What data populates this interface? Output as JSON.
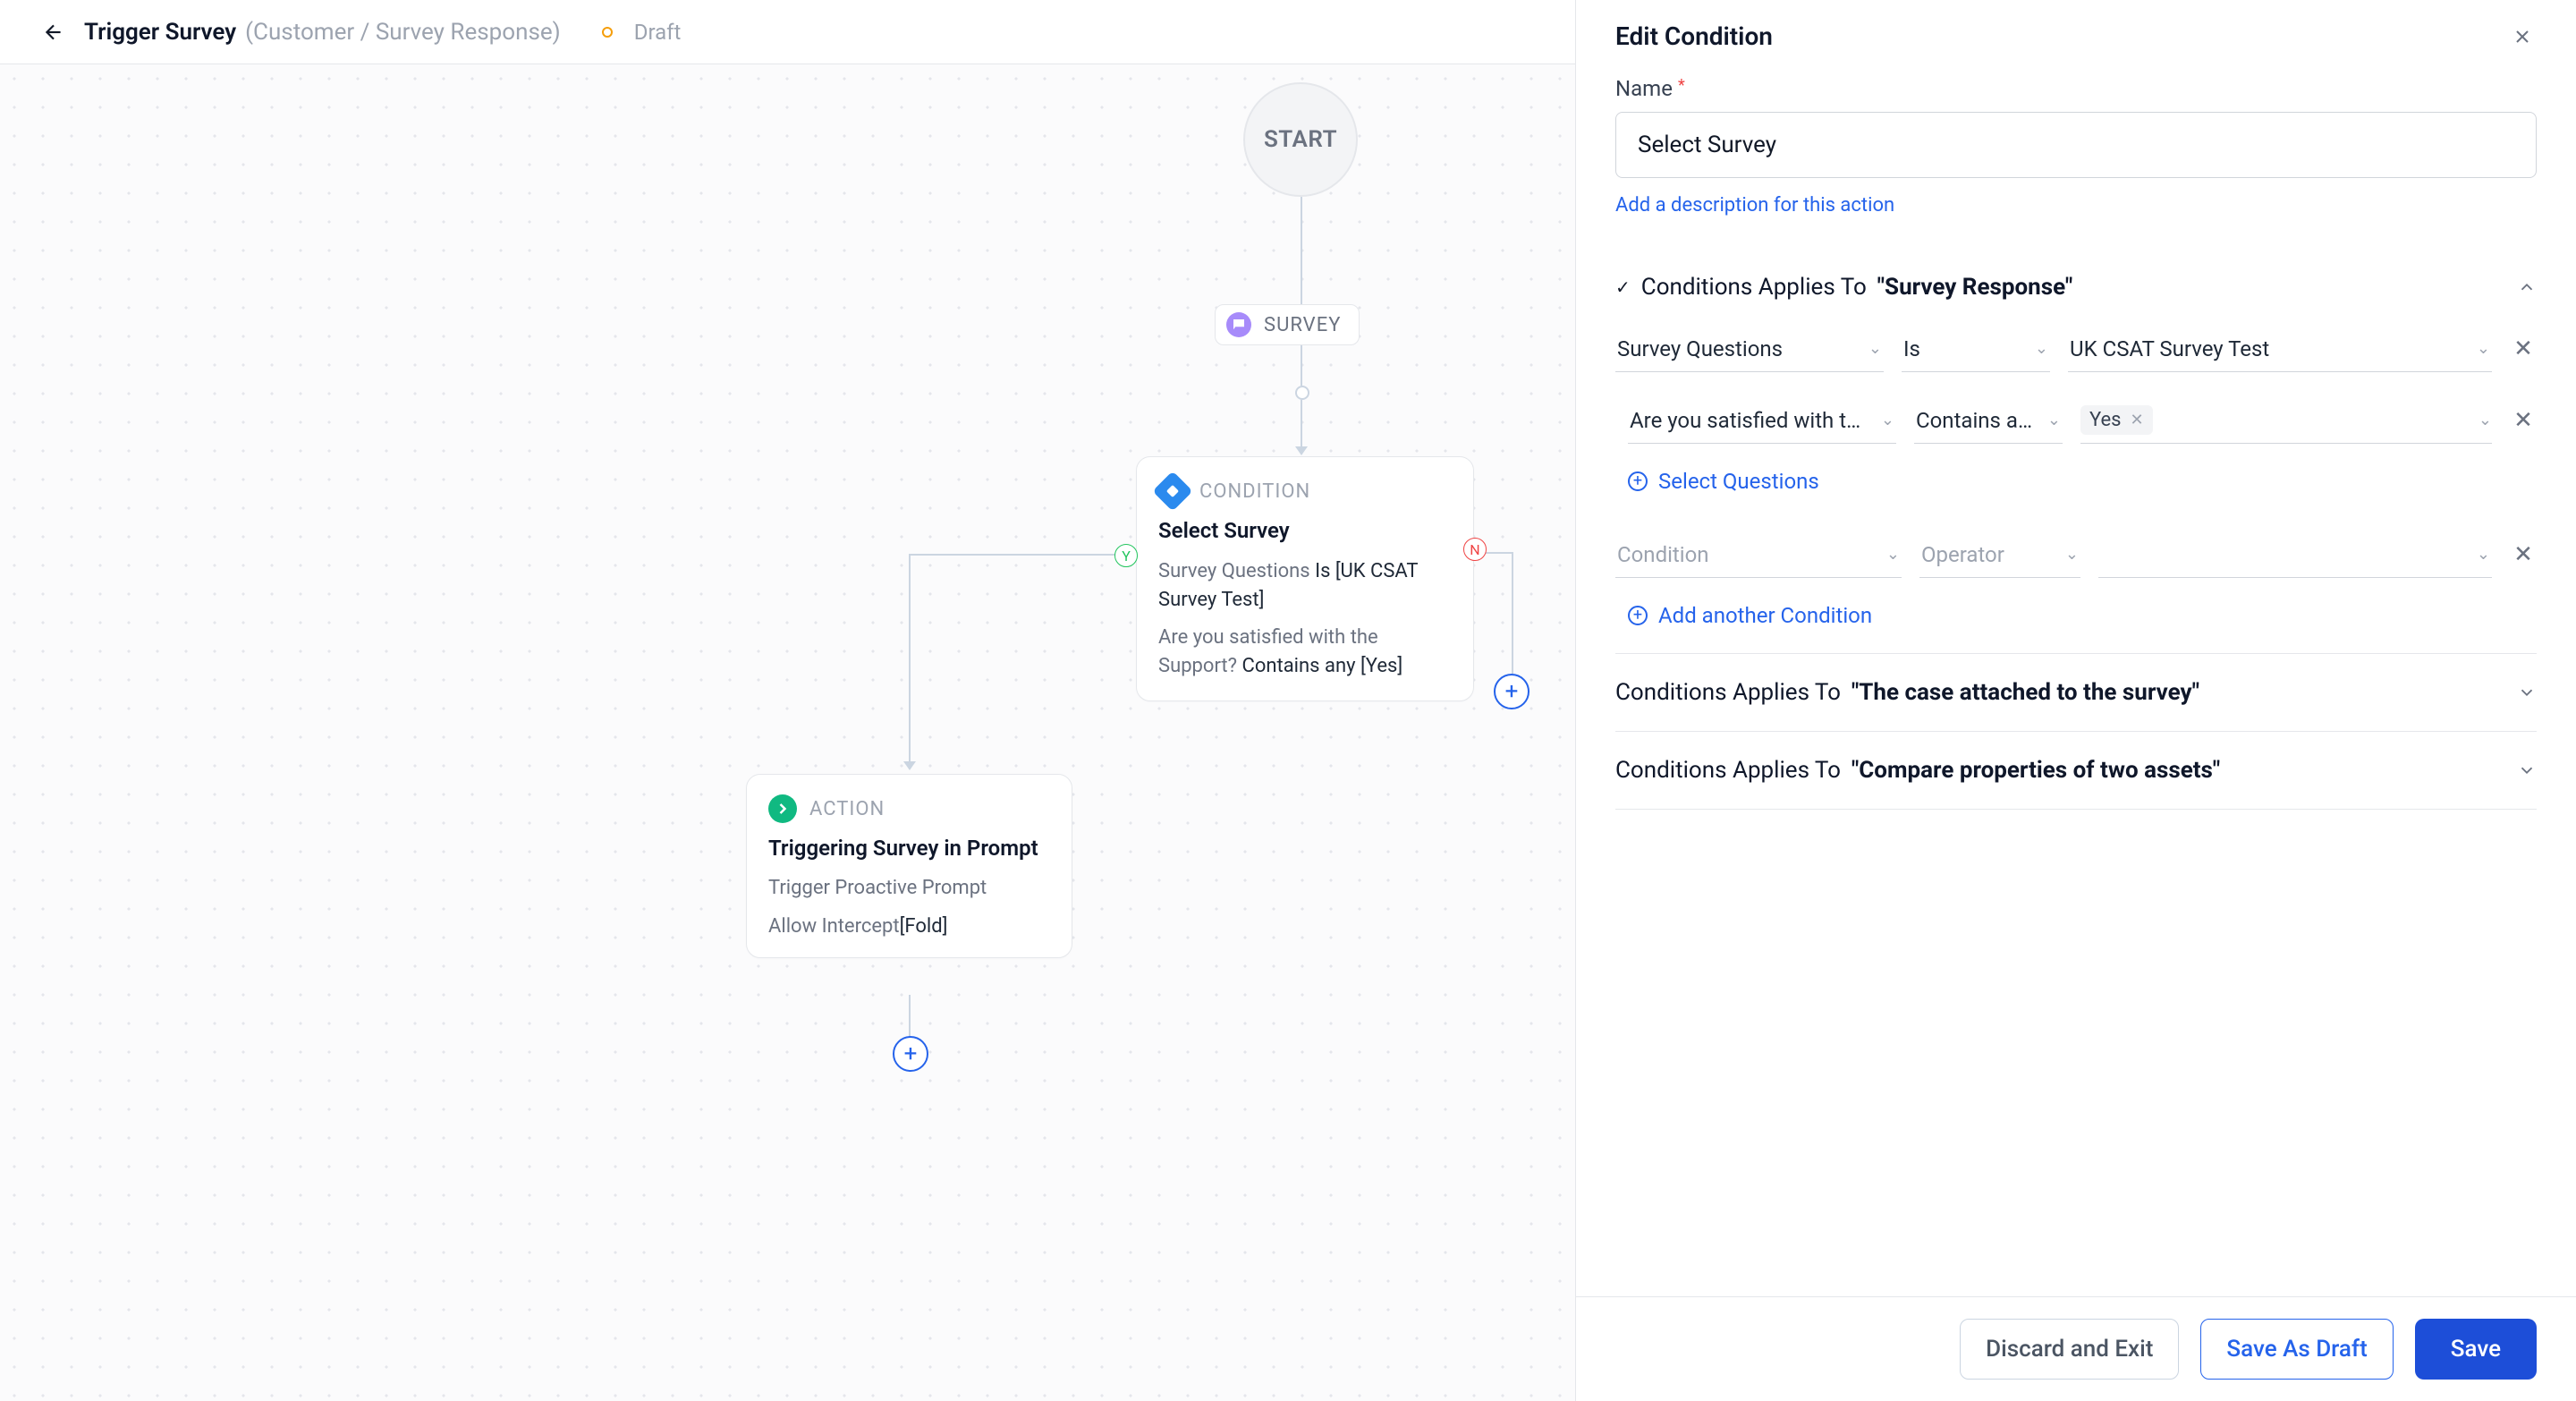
{
  "header": {
    "title": "Trigger Survey",
    "subtitle": "(Customer / Survey Response)",
    "status": "Draft"
  },
  "flow": {
    "start_label": "START",
    "survey_pill": "SURVEY",
    "condition": {
      "type_label": "CONDITION",
      "title": "Select Survey",
      "line1_prefix": "Survey Questions ",
      "line1_strong": "Is [UK CSAT Survey Test]",
      "line2_prefix": "Are you satisfied with the Support? ",
      "line2_strong": "Contains any [Yes]",
      "yes": "Y",
      "no": "N"
    },
    "action": {
      "type_label": "ACTION",
      "title": "Triggering Survey in Prompt",
      "row1": "Trigger Proactive Prompt",
      "row2_prefix": "Allow Intercept",
      "row2_strong": "[Fold]"
    }
  },
  "panel": {
    "title": "Edit Condition",
    "name_label": "Name",
    "name_value": "Select Survey",
    "add_description": "Add a description for this action",
    "sections": {
      "s1_prefix": "Conditions Applies To ",
      "s1_strong": "\"Survey Response\"",
      "s2_prefix": "Conditions Applies To ",
      "s2_strong": "\"The case attached to the survey\"",
      "s3_prefix": "Conditions Applies To ",
      "s3_strong": "\"Compare properties of two assets\"",
      "row1": {
        "field": "Survey Questions",
        "op": "Is",
        "val": "UK CSAT Survey Test"
      },
      "row2": {
        "field": "Are you satisfied with t…",
        "op": "Contains any",
        "chip": "Yes"
      },
      "select_questions": "Select Questions",
      "row3": {
        "field_ph": "Condition",
        "op_ph": "Operator"
      },
      "add_condition": "Add another Condition"
    }
  },
  "footer": {
    "discard": "Discard and Exit",
    "draft": "Save As Draft",
    "save": "Save"
  }
}
